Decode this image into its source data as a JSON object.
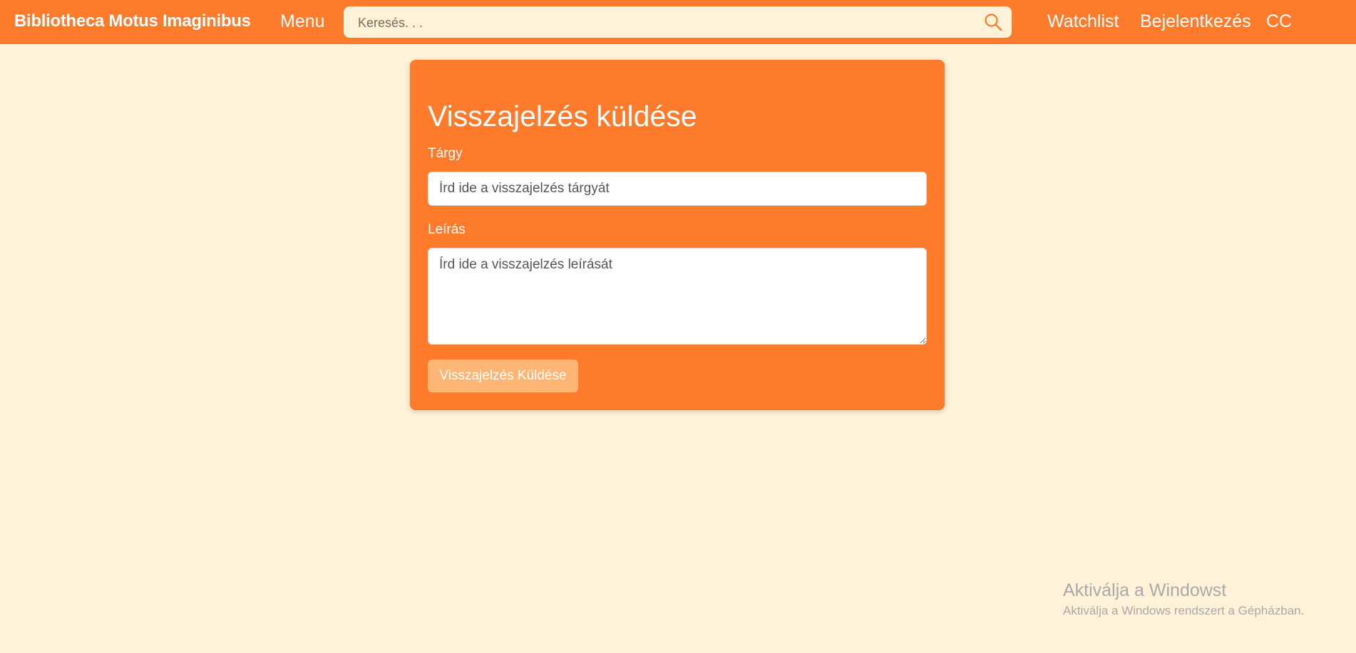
{
  "navbar": {
    "brand": "Bibliotheca Motus Imaginibus",
    "menu_label": "Menu",
    "search": {
      "placeholder": "Keresés. . ."
    },
    "links": {
      "watchlist": "Watchlist",
      "login": "Bejelentkezés",
      "cc": "CC"
    }
  },
  "form": {
    "title": "Visszajelzés küldése",
    "subject_label": "Tárgy",
    "subject_placeholder": "Írd ide a visszajelzés tárgyát",
    "description_label": "Leírás",
    "description_placeholder": "Írd ide a visszajelzés leírását",
    "submit_label": "Visszajelzés Küldése"
  },
  "watermark": {
    "title": "Aktiválja a Windowst",
    "subtitle": "Aktiválja a Windows rendszert a Gépházban."
  },
  "colors": {
    "accent": "#ff7b2c",
    "background": "#fff2d8",
    "button_disabled": "#ffb573",
    "text_light": "#ffffff"
  },
  "icons": {
    "search": "search-icon"
  }
}
